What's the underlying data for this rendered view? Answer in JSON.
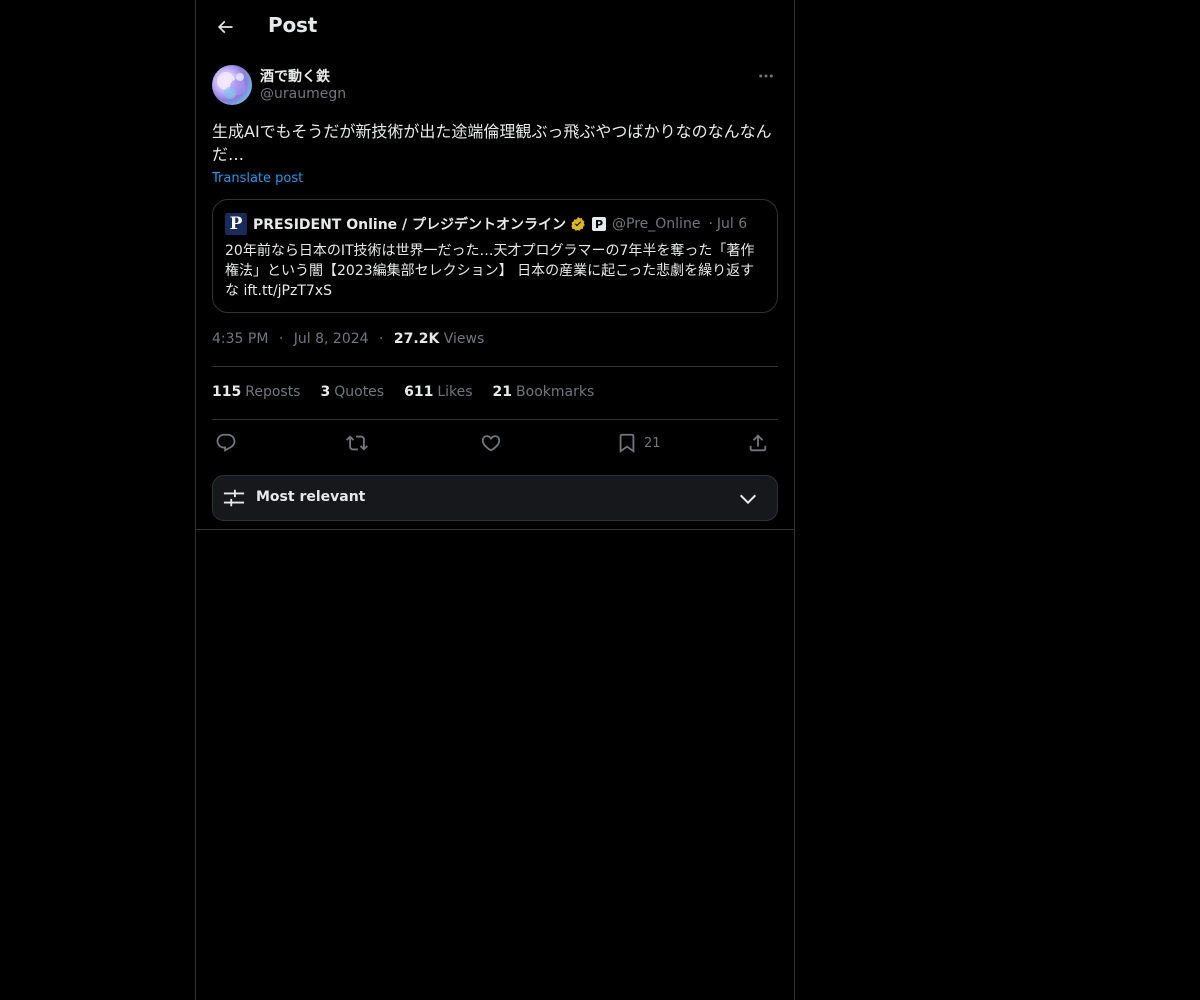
{
  "header": {
    "title": "Post"
  },
  "post": {
    "author": {
      "display_name": "酒で動く鉄",
      "handle": "@uraumegn"
    },
    "text": "生成AIでもそうだが新技術が出た途端倫理観ぶっ飛ぶやつばかりなのなんなんだ…",
    "translate_label": "Translate post",
    "quote": {
      "logo_letter": "P",
      "name": "PRESIDENT Online / プレジデントオンライン",
      "badge_letter": "P",
      "handle": "@Pre_Online",
      "separator": "·",
      "date": "Jul 6",
      "text": "20年前なら日本のIT技術は世界一だった…天才プログラマーの7年半を奪った「著作権法」という闇【2023編集部セレクション】 日本の産業に起こった悲劇を繰り返すな ift.tt/jPzT7xS"
    },
    "meta": {
      "time": "4:35 PM",
      "separator": "·",
      "date": "Jul 8, 2024",
      "views_count": "27.2K",
      "views_label": "Views"
    },
    "stats": [
      {
        "count": "115",
        "label": "Reposts"
      },
      {
        "count": "3",
        "label": "Quotes"
      },
      {
        "count": "611",
        "label": "Likes"
      },
      {
        "count": "21",
        "label": "Bookmarks"
      }
    ],
    "actions": {
      "reply_icon": "reply-icon",
      "repost_icon": "repost-icon",
      "like_icon": "heart-icon",
      "bookmark_icon": "bookmark-icon",
      "bookmark_count": "21",
      "share_icon": "share-icon"
    }
  },
  "sort": {
    "label": "Most relevant"
  },
  "colors": {
    "background": "#000000",
    "text": "#e7e9ea",
    "secondary_text": "#71767b",
    "accent": "#1d9bf0",
    "border": "#2f3336",
    "verified_gold": "#e2b719"
  }
}
